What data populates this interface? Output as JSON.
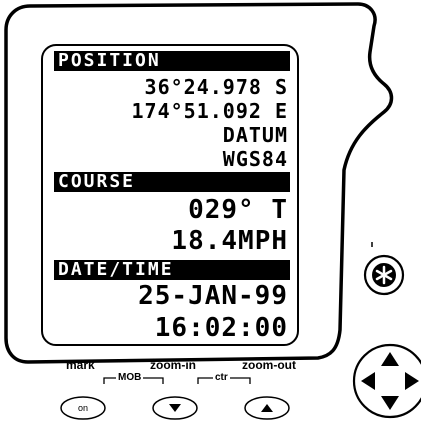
{
  "screen": {
    "position": {
      "header": "POSITION",
      "latitude": "36°24.978 S",
      "longitude": "174°51.092 E",
      "datum_label": "DATUM",
      "datum_value": "WGS84"
    },
    "course": {
      "header": "COURSE",
      "heading": "029° T",
      "speed": "18.4MPH"
    },
    "datetime": {
      "header": "DATE/TIME",
      "date": "25-JAN-99",
      "time": "16:02:00"
    }
  },
  "controls": {
    "mark_label": "mark",
    "zoom_in_label": "zoom-in",
    "zoom_out_label": "zoom-out",
    "mob_label": "MOB",
    "ctr_label": "ctr",
    "on_button_label": "on",
    "down_icon": "triangle-down-icon",
    "up_icon": "triangle-up-icon",
    "star_icon": "star-icon",
    "dpad_icon": "dpad-icon"
  }
}
